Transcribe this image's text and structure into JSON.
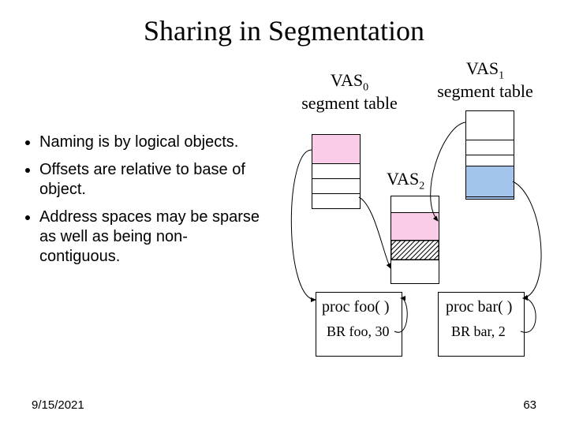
{
  "title": "Sharing in Segmentation",
  "bullets": {
    "b1": "Naming is by logical objects.",
    "b2": "Offsets are relative to base of object.",
    "b3": "Address spaces may be sparse as well as being non-contiguous."
  },
  "labels": {
    "vas0_a": "VAS",
    "vas0_sub": "0",
    "vas0_b": "segment table",
    "vas1_a": "VAS",
    "vas1_sub": "1",
    "vas1_b": "segment table",
    "vas2_a": "VAS",
    "vas2_sub": "2",
    "proc_foo": "proc foo( )",
    "br_foo": "BR foo, 30",
    "proc_bar": "proc bar( )",
    "br_bar": "BR bar, 2"
  },
  "footer": {
    "date": "9/15/2021",
    "page": "63"
  }
}
